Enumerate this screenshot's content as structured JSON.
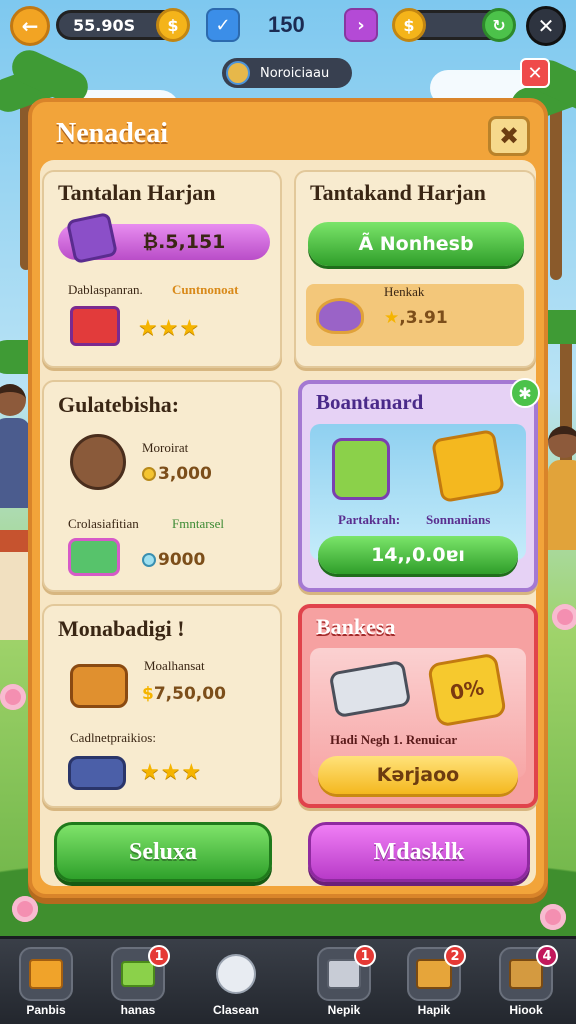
{
  "topbar": {
    "coins_value": "55.90S",
    "center_value": "150",
    "notification_label": "Noroiciaau"
  },
  "panel": {
    "title": "Nenadeai",
    "cards": {
      "card1": {
        "title": "Tantalan Harjan",
        "bar_value": "₿.5,151",
        "label_left": "Dablaspanran.",
        "label_right": "Cuntnonoat",
        "stars": 3
      },
      "card2": {
        "title": "Tantakand Harjan",
        "button_label": "Ã Nonhesb",
        "label": "Henkak",
        "value": ",3.91"
      },
      "card3": {
        "title": "Gulatebisha:",
        "label1": "Moroirat",
        "value1": "3,000",
        "label2_left": "Crolasiafitian",
        "label2_right": "Fmntarsel",
        "value2": "9000"
      },
      "card4": {
        "title": "Boantanard",
        "caption_left": "Partakrah:",
        "caption_right": "Sonnanians",
        "bar_value": "14,,0.0ɐı"
      },
      "card5": {
        "title": "Monabadigi !",
        "label1": "Moalhansat",
        "value1": "7,50,00",
        "label2": "Cadlnetpraikios:",
        "stars": 3
      },
      "card6": {
        "title": "Bankesa",
        "badge_text": "0%",
        "caption": "Hadi Negh 1. Renuicar",
        "bar_value": "Kərjaoo"
      }
    },
    "buttons": {
      "left": "Seluxa",
      "right": "Mdasklk"
    }
  },
  "bottom_nav": [
    {
      "label": "Panbis",
      "badge": ""
    },
    {
      "label": "hanas",
      "badge": "1"
    },
    {
      "label": "Clasean",
      "badge": ""
    },
    {
      "label": "Nepik",
      "badge": "1"
    },
    {
      "label": "Hapik",
      "badge": "2"
    },
    {
      "label": "Hiook",
      "badge": "4"
    }
  ],
  "colors": {
    "panel_orange": "#f2a43a",
    "green_button": "#2fa12b",
    "pink_button": "#b83bc8",
    "card_purple_border": "#a479d2",
    "card_red_border": "#e0434b"
  }
}
